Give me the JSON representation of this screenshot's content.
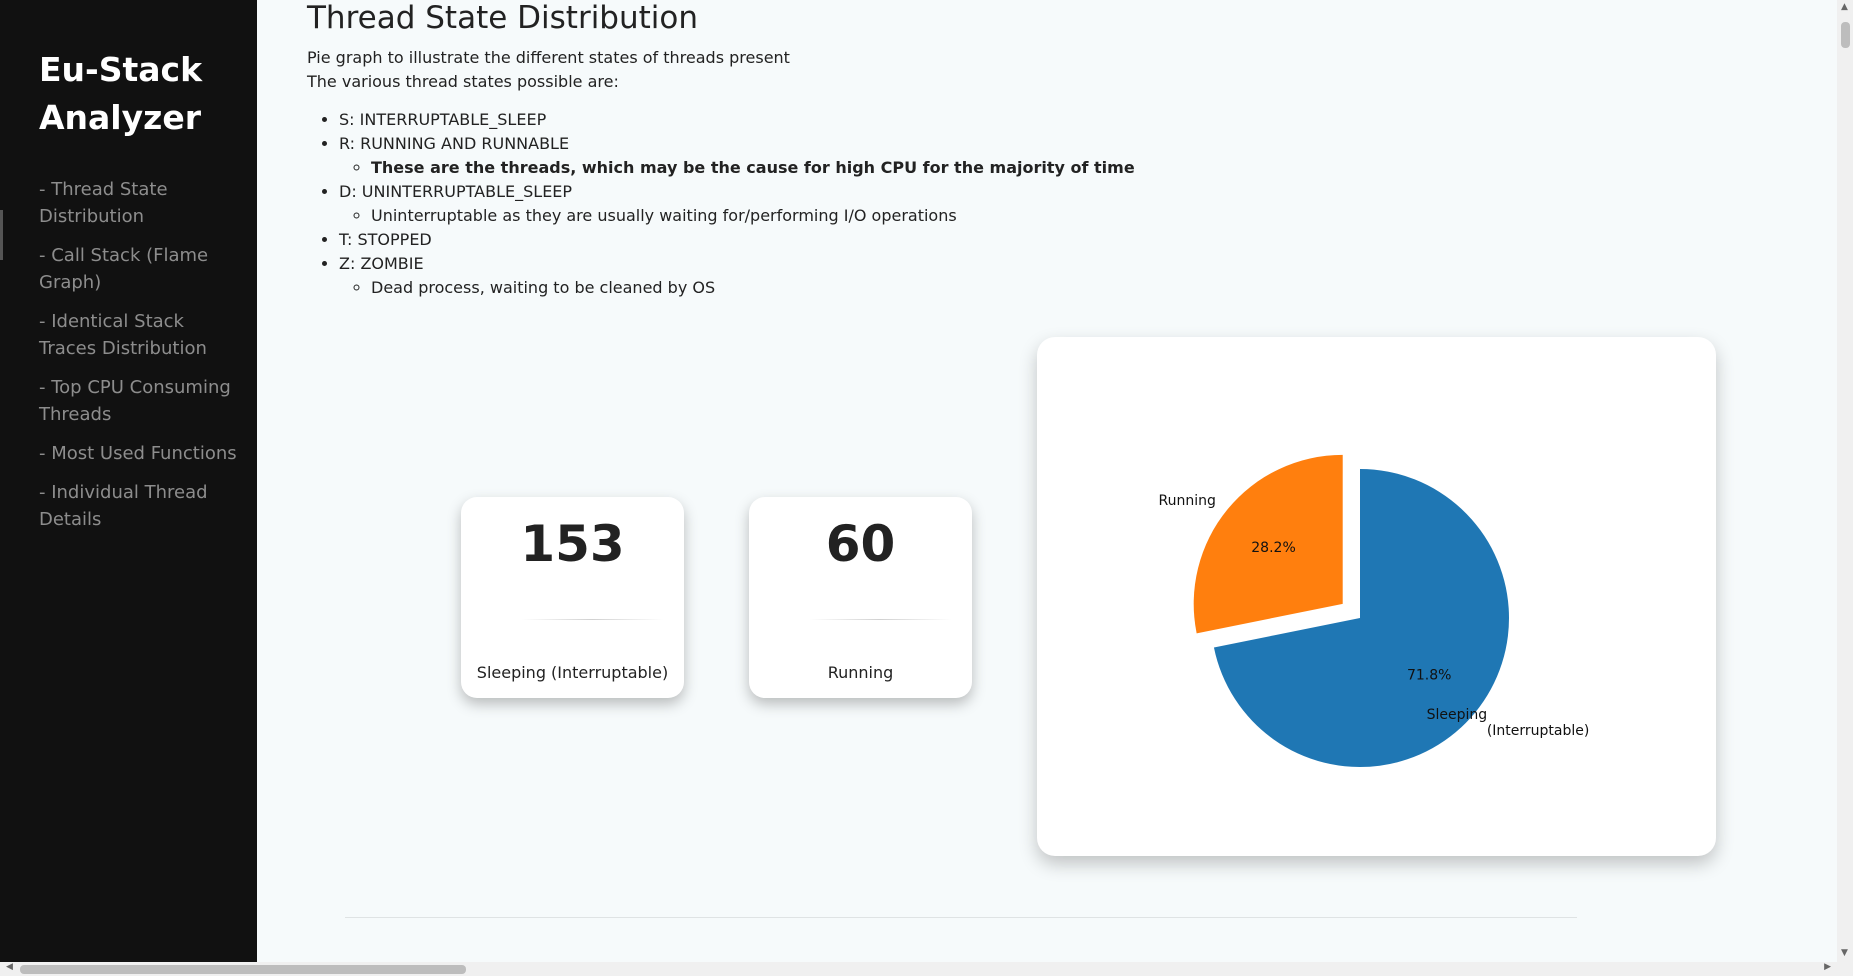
{
  "sidebar": {
    "brand": "Eu-Stack Analyzer",
    "items": [
      {
        "label": "- Thread State Distribution"
      },
      {
        "label": "- Call Stack (Flame Graph)"
      },
      {
        "label": "- Identical Stack Traces Distribution"
      },
      {
        "label": "- Top CPU Consuming Threads"
      },
      {
        "label": "- Most Used Functions"
      },
      {
        "label": "- Individual Thread Details"
      }
    ]
  },
  "main": {
    "title": "Thread State Distribution",
    "desc_line1": "Pie graph to illustrate the different states of threads present",
    "desc_line2": "The various thread states possible are:",
    "states": {
      "s": "S: INTERRUPTABLE_SLEEP",
      "r": "R: RUNNING AND RUNNABLE",
      "r_note": "These are the threads, which may be the cause for high CPU for the majority of time",
      "d": "D: UNINTERRUPTABLE_SLEEP",
      "d_note": "Uninterruptable as they are usually waiting for/performing I/O operations",
      "t": "T: STOPPED",
      "z": "Z: ZOMBIE",
      "z_note": "Dead process, waiting to be cleaned by OS"
    },
    "cards": [
      {
        "count": "153",
        "label": "Sleeping (Interruptable)"
      },
      {
        "count": "60",
        "label": "Running"
      }
    ]
  },
  "chart_data": {
    "type": "pie",
    "slices": [
      {
        "label": "Running",
        "value": 60,
        "pct_label": "28.2%",
        "color": "#ff7f0e",
        "exploded": true
      },
      {
        "label": "Sleeping\n(Interruptable)",
        "value": 153,
        "pct_label": "71.8%",
        "color": "#1f77b4",
        "exploded": false
      }
    ],
    "start_angle_deg": 90,
    "direction": "counterclockwise"
  }
}
